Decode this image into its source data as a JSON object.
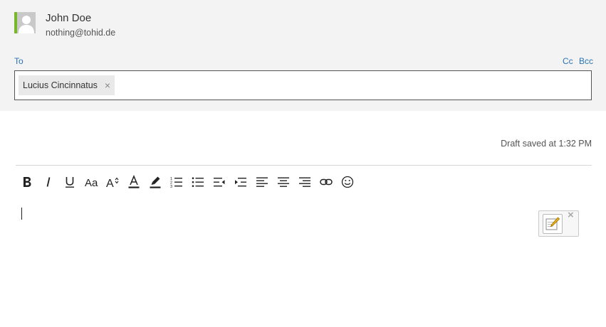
{
  "sender": {
    "name": "John Doe",
    "email": "nothing@tohid.de"
  },
  "recipients": {
    "to_label": "To",
    "cc_label": "Cc",
    "bcc_label": "Bcc",
    "to_chips": [
      {
        "label": "Lucius Cincinnatus",
        "remove_glyph": "×"
      }
    ]
  },
  "draft_status": "Draft saved at 1:32 PM",
  "toolbar": {
    "buttons": [
      {
        "name": "bold",
        "icon": "bold-icon"
      },
      {
        "name": "italic",
        "icon": "italic-icon"
      },
      {
        "name": "underline",
        "icon": "underline-icon"
      },
      {
        "name": "font-family",
        "icon": "font-family-icon"
      },
      {
        "name": "font-size",
        "icon": "font-size-icon"
      },
      {
        "name": "font-color",
        "icon": "font-color-icon"
      },
      {
        "name": "highlight",
        "icon": "highlighter-icon"
      },
      {
        "name": "numbered-list",
        "icon": "numbered-list-icon"
      },
      {
        "name": "bulleted-list",
        "icon": "bulleted-list-icon"
      },
      {
        "name": "decrease-indent",
        "icon": "outdent-icon"
      },
      {
        "name": "increase-indent",
        "icon": "indent-icon"
      },
      {
        "name": "align-left",
        "icon": "align-left-icon"
      },
      {
        "name": "align-center",
        "icon": "align-center-icon"
      },
      {
        "name": "align-right",
        "icon": "align-right-icon"
      },
      {
        "name": "insert-link",
        "icon": "link-icon"
      },
      {
        "name": "insert-emoji",
        "icon": "emoji-icon"
      }
    ]
  },
  "floating_widget": {
    "icon": "note-edit-icon",
    "close_glyph": "×"
  },
  "colors": {
    "header_bg": "#f3f3f3",
    "link": "#2a74b5",
    "avatar_accent": "#77b82a"
  }
}
